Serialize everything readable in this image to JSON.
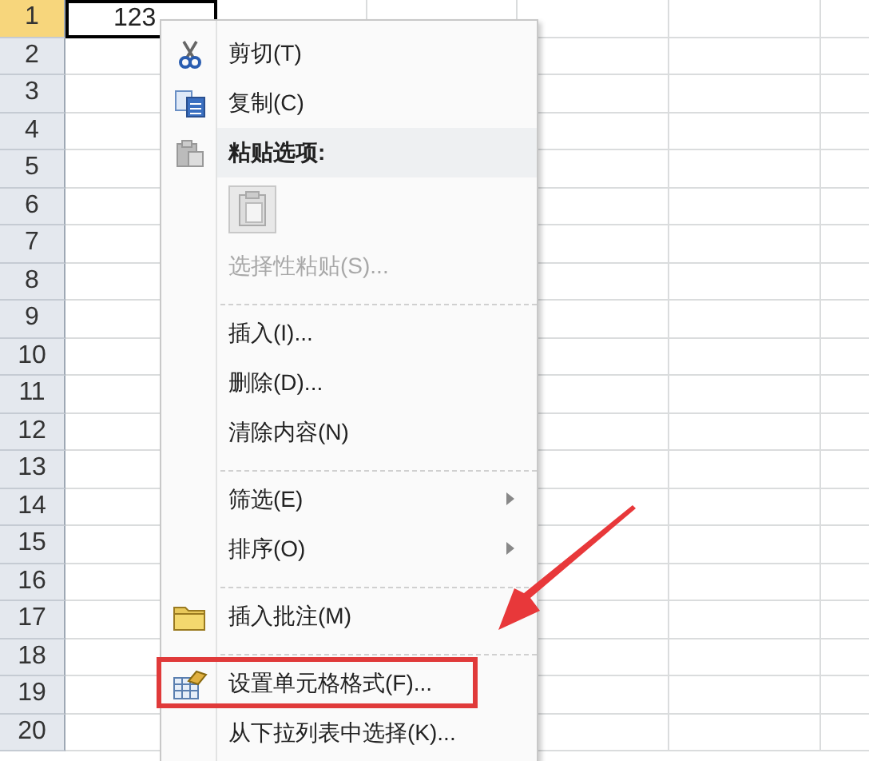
{
  "sheet": {
    "rows": [
      {
        "label": "1",
        "selected": true
      },
      {
        "label": "2",
        "selected": false
      },
      {
        "label": "3",
        "selected": false
      },
      {
        "label": "4",
        "selected": false
      },
      {
        "label": "5",
        "selected": false
      },
      {
        "label": "6",
        "selected": false
      },
      {
        "label": "7",
        "selected": false
      },
      {
        "label": "8",
        "selected": false
      },
      {
        "label": "9",
        "selected": false
      },
      {
        "label": "10",
        "selected": false
      },
      {
        "label": "11",
        "selected": false
      },
      {
        "label": "12",
        "selected": false
      },
      {
        "label": "13",
        "selected": false
      },
      {
        "label": "14",
        "selected": false
      },
      {
        "label": "15",
        "selected": false
      },
      {
        "label": "16",
        "selected": false
      },
      {
        "label": "17",
        "selected": false
      },
      {
        "label": "18",
        "selected": false
      },
      {
        "label": "19",
        "selected": false
      },
      {
        "label": "20",
        "selected": false
      }
    ],
    "cell_a1": "123"
  },
  "context_menu": {
    "items": [
      {
        "kind": "item",
        "label": "剪切(T)",
        "disabled": false,
        "submenu": false,
        "highlighted": false
      },
      {
        "kind": "item",
        "label": "复制(C)",
        "disabled": false,
        "submenu": false,
        "highlighted": false
      },
      {
        "kind": "header",
        "label": "粘贴选项:"
      },
      {
        "kind": "paste_icons"
      },
      {
        "kind": "item",
        "label": "选择性粘贴(S)...",
        "disabled": true,
        "submenu": false,
        "highlighted": false
      },
      {
        "kind": "separator"
      },
      {
        "kind": "item",
        "label": "插入(I)...",
        "disabled": false,
        "submenu": false,
        "highlighted": false
      },
      {
        "kind": "item",
        "label": "删除(D)...",
        "disabled": false,
        "submenu": false,
        "highlighted": false
      },
      {
        "kind": "item",
        "label": "清除内容(N)",
        "disabled": false,
        "submenu": false,
        "highlighted": false
      },
      {
        "kind": "separator"
      },
      {
        "kind": "item",
        "label": "筛选(E)",
        "disabled": false,
        "submenu": true,
        "highlighted": false
      },
      {
        "kind": "item",
        "label": "排序(O)",
        "disabled": false,
        "submenu": true,
        "highlighted": false
      },
      {
        "kind": "separator"
      },
      {
        "kind": "item",
        "label": "插入批注(M)",
        "disabled": false,
        "submenu": false,
        "highlighted": false
      },
      {
        "kind": "separator"
      },
      {
        "kind": "item",
        "label": "设置单元格格式(F)...",
        "disabled": false,
        "submenu": false,
        "highlighted": true
      },
      {
        "kind": "item",
        "label": "从下拉列表中选择(K)...",
        "disabled": false,
        "submenu": false,
        "highlighted": false
      }
    ]
  }
}
